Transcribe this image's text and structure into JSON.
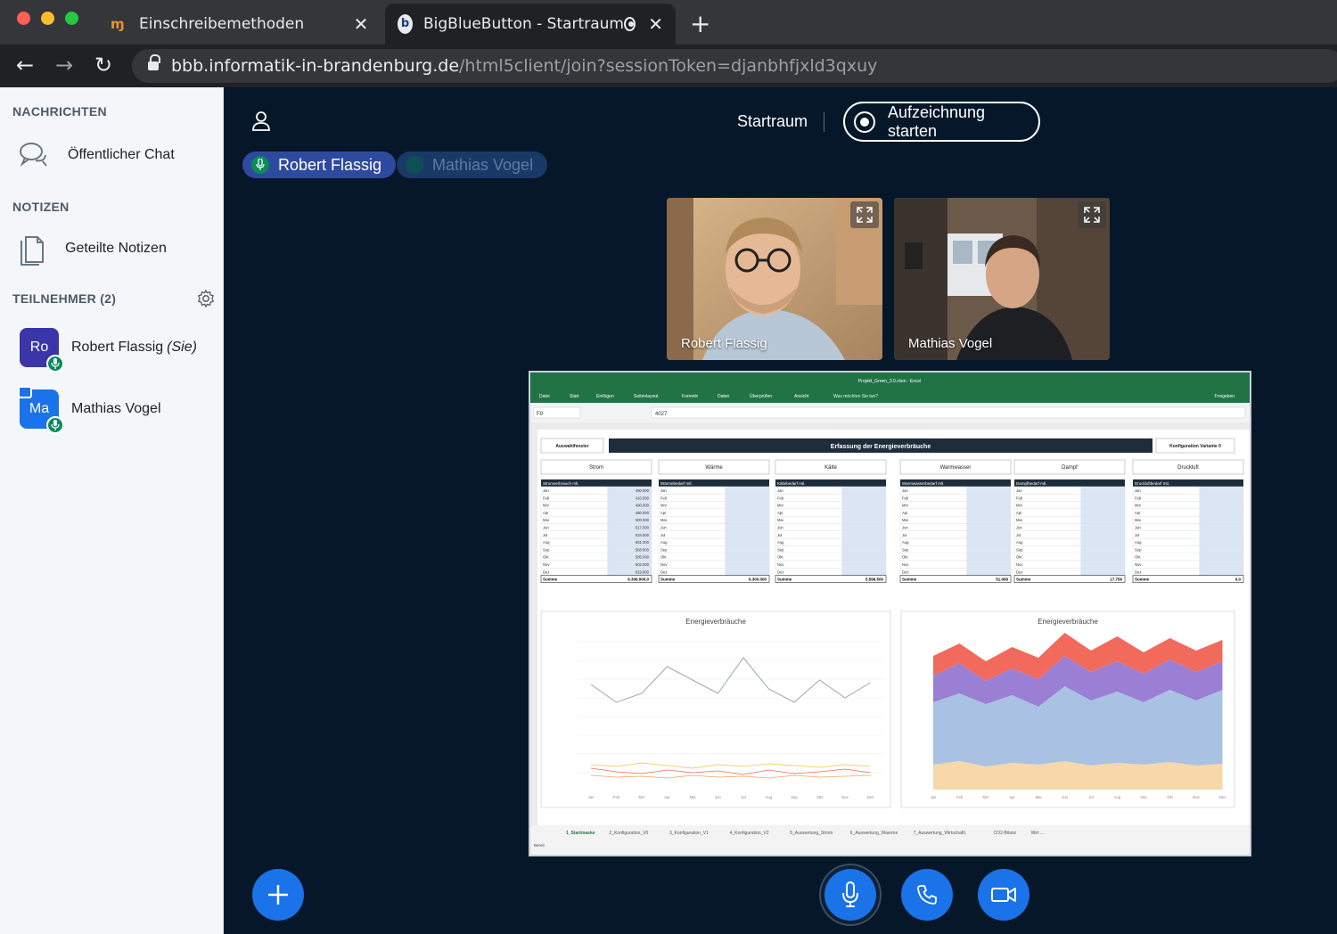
{
  "browser": {
    "tabs": [
      {
        "title": "Einschreibemethoden",
        "favicon": "moodle-icon"
      },
      {
        "title": "BigBlueButton - Startraum",
        "favicon": "bbb-icon",
        "recording": true
      }
    ],
    "url_host": "bbb.informatik-in-brandenburg.de",
    "url_path": "/html5client/join?sessionToken=djanbhfjxld3qxuy"
  },
  "sidebar": {
    "messages_title": "NACHRICHTEN",
    "public_chat": "Öffentlicher Chat",
    "notes_title": "NOTIZEN",
    "shared_notes": "Geteilte Notizen",
    "participants_title": "TEILNEHMER (2)",
    "users": [
      {
        "initials": "Ro",
        "name": "Robert Flassig",
        "suffix": "(Sie)",
        "color": "#3a35a8"
      },
      {
        "initials": "Ma",
        "name": "Mathias Vogel",
        "suffix": "",
        "color": "#1a73e8"
      }
    ]
  },
  "main": {
    "room_name": "Startraum",
    "record_label": "Aufzeichnung starten",
    "talkers": [
      "Robert Flassig",
      "Mathias Vogel"
    ],
    "videos": [
      {
        "name": "Robert Flassig"
      },
      {
        "name": "Mathias Vogel"
      }
    ]
  },
  "excel": {
    "title": "Projekt_Green_3.0.xlsm - Excel",
    "ribbon_tabs": [
      "Datei",
      "Start",
      "Einfügen",
      "Seitenlayout",
      "Formeln",
      "Daten",
      "Überprüfen",
      "Ansicht"
    ],
    "tell_me": "Was möchten Sie tun?",
    "share": "Freigeben",
    "cell_ref": "F9",
    "formula_value": "4027",
    "left_panel": "Auswahlfenster",
    "sheet_title": "Erfassung der Energieverbräuche",
    "right_panel": "Konfiguration Variante 0",
    "categories": [
      "Strom",
      "Wärme",
      "Kälte",
      "Warmwasser",
      "Dampf",
      "Druckluft"
    ],
    "table_headers": [
      "Stromverbrauch mtl.",
      "Wärmebedarf mtl.",
      "Kältebedarf mtl.",
      "Warmwasserbedarf mtl.",
      "Dampfbedarf mtl.",
      "Druckluftbedarf mtl."
    ],
    "months": [
      "Jan",
      "Feb",
      "Mrz",
      "Apr",
      "Mai",
      "Jun",
      "Jul",
      "Aug",
      "Sep",
      "Okt",
      "Nov",
      "Dez"
    ],
    "sum_label": "Summe",
    "sums": [
      "6.306.000,0",
      "6.300.000",
      "5.596.500",
      "51.069",
      "17.756",
      "0,0"
    ],
    "strom_values": [
      "450.000",
      "410.000",
      "490.000",
      "480.000",
      "500.000",
      "517.000",
      "534.000",
      "551.000",
      "568.000",
      "585.000",
      "602.000",
      "619.000"
    ],
    "chart_title_1": "Energieverbräuche",
    "chart_title_2": "Energieverbräuche",
    "sheet_tabs": [
      "1_Startmaske",
      "2_Konfiguration_V0",
      "3_Konfiguration_V1",
      "4_Konfiguration_V2",
      "5_Auswertung_Strom",
      "6_Auswertung_Waerme",
      "7_Auswertung_Wirtschaftl.",
      "CO2-Bilanz",
      "Wirt ..."
    ],
    "status": "Bereit"
  },
  "colors": {
    "accent": "#1a73e8",
    "excel_green": "#217346",
    "talk_green": "#0b8a5c",
    "background": "#06172a"
  }
}
